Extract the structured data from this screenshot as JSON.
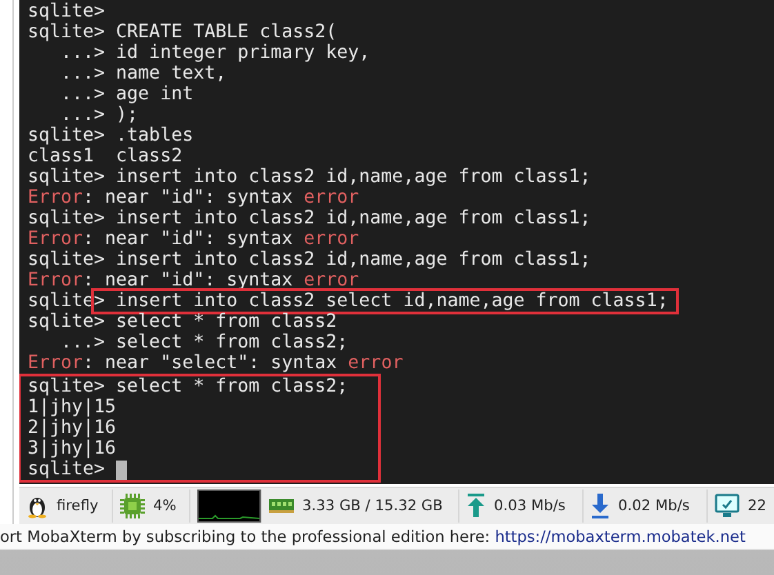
{
  "terminal": {
    "cursor_visible": true,
    "groups": [
      {
        "framed": false,
        "lines": [
          {
            "segments": [
              {
                "kind": "plain",
                "text": "sqlite>"
              }
            ]
          },
          {
            "segments": [
              {
                "kind": "plain",
                "text": "sqlite> CREATE TABLE class2("
              }
            ]
          },
          {
            "segments": [
              {
                "kind": "plain",
                "text": "   ...> id integer primary key,"
              }
            ]
          },
          {
            "segments": [
              {
                "kind": "plain",
                "text": "   ...> name text,"
              }
            ]
          },
          {
            "segments": [
              {
                "kind": "plain",
                "text": "   ...> age int"
              }
            ]
          },
          {
            "segments": [
              {
                "kind": "plain",
                "text": "   ...> );"
              }
            ]
          },
          {
            "segments": [
              {
                "kind": "plain",
                "text": "sqlite> .tables"
              }
            ]
          },
          {
            "segments": [
              {
                "kind": "plain",
                "text": "class1  class2"
              }
            ]
          },
          {
            "segments": [
              {
                "kind": "plain",
                "text": "sqlite> insert into class2 id,name,age from class1;"
              }
            ]
          },
          {
            "segments": [
              {
                "kind": "error",
                "text": "Error"
              },
              {
                "kind": "plain",
                "text": ": near \"id\": syntax "
              },
              {
                "kind": "error",
                "text": "error"
              }
            ]
          },
          {
            "segments": [
              {
                "kind": "plain",
                "text": "sqlite> insert into class2 id,name,age from class1;"
              }
            ]
          },
          {
            "segments": [
              {
                "kind": "error",
                "text": "Error"
              },
              {
                "kind": "plain",
                "text": ": near \"id\": syntax "
              },
              {
                "kind": "error",
                "text": "error"
              }
            ]
          },
          {
            "segments": [
              {
                "kind": "plain",
                "text": "sqlite> insert into class2 id,name,age from class1;"
              }
            ]
          },
          {
            "segments": [
              {
                "kind": "error",
                "text": "Error"
              },
              {
                "kind": "plain",
                "text": ": near \"id\": syntax "
              },
              {
                "kind": "error",
                "text": "error"
              }
            ]
          },
          {
            "segments": [
              {
                "kind": "plain",
                "text": "sqlite"
              },
              {
                "kind": "framed",
                "text": "> insert into class2 select id,name,age from class1;"
              }
            ]
          },
          {
            "segments": [
              {
                "kind": "plain",
                "text": "sqlite> select * from class2"
              }
            ]
          },
          {
            "segments": [
              {
                "kind": "plain",
                "text": "   ...> select * from class2;"
              }
            ]
          },
          {
            "segments": [
              {
                "kind": "error",
                "text": "Error"
              },
              {
                "kind": "plain",
                "text": ": near \"select\": syntax "
              },
              {
                "kind": "error",
                "text": "error"
              }
            ]
          }
        ]
      },
      {
        "framed": true,
        "lines": [
          {
            "segments": [
              {
                "kind": "plain",
                "text": "sqlite> select * from class2;"
              }
            ]
          },
          {
            "segments": [
              {
                "kind": "plain",
                "text": "1|jhy|15"
              }
            ]
          },
          {
            "segments": [
              {
                "kind": "plain",
                "text": "2|jhy|16"
              }
            ]
          },
          {
            "segments": [
              {
                "kind": "plain",
                "text": "3|jhy|16"
              }
            ]
          },
          {
            "segments": [
              {
                "kind": "plain",
                "text": "sqlite> "
              }
            ]
          }
        ]
      }
    ]
  },
  "status_bar": [
    {
      "kind": "host",
      "text": "firefly"
    },
    {
      "kind": "cpu",
      "text": "4%"
    },
    {
      "kind": "graph"
    },
    {
      "kind": "memory",
      "text": "3.33 GB / 15.32 GB"
    },
    {
      "kind": "upload",
      "text": "0.03 Mb/s"
    },
    {
      "kind": "download",
      "text": "0.02 Mb/s"
    },
    {
      "kind": "uptime",
      "text": "22"
    }
  ],
  "footer": {
    "message": "ort MobaXterm by subscribing to the professional edition here: ",
    "link": "https://mobaxterm.mobatek.net"
  }
}
